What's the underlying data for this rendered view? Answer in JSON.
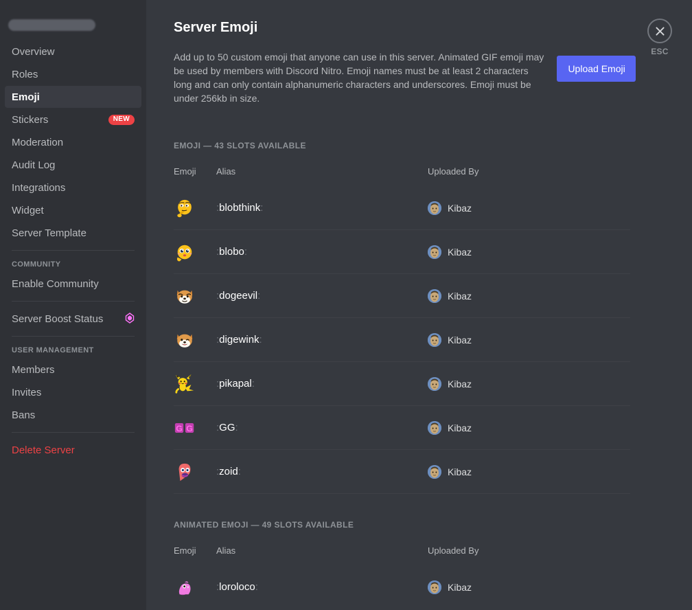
{
  "sidebar": {
    "server_name_redacted": "",
    "items": [
      {
        "label": "Overview",
        "active": false
      },
      {
        "label": "Roles",
        "active": false
      },
      {
        "label": "Emoji",
        "active": true
      },
      {
        "label": "Stickers",
        "active": false,
        "badge": "NEW"
      },
      {
        "label": "Moderation",
        "active": false
      },
      {
        "label": "Audit Log",
        "active": false
      },
      {
        "label": "Integrations",
        "active": false
      },
      {
        "label": "Widget",
        "active": false
      },
      {
        "label": "Server Template",
        "active": false
      }
    ],
    "community_header": "COMMUNITY",
    "community_items": [
      {
        "label": "Enable Community"
      }
    ],
    "boost_item": {
      "label": "Server Boost Status",
      "icon": "boost-gem-icon",
      "icon_color": "#ff73fa"
    },
    "user_management_header": "USER MANAGEMENT",
    "user_management_items": [
      {
        "label": "Members"
      },
      {
        "label": "Invites"
      },
      {
        "label": "Bans"
      }
    ],
    "danger_item": {
      "label": "Delete Server",
      "color": "#ed4245"
    }
  },
  "header": {
    "title": "Server Emoji",
    "description": "Add up to 50 custom emoji that anyone can use in this server. Animated GIF emoji may be used by members with Discord Nitro. Emoji names must be at least 2 characters long and can only contain alphanumeric characters and underscores. Emoji must be under 256kb in size.",
    "upload_button": "Upload Emoji",
    "upload_button_color": "#5865f2"
  },
  "close": {
    "icon": "close-x-icon",
    "label": "ESC"
  },
  "sections": [
    {
      "title": "EMOJI — 43 SLOTS AVAILABLE",
      "columns": {
        "emoji": "Emoji",
        "alias": "Alias",
        "uploader": "Uploaded By"
      },
      "rows": [
        {
          "emoji_name": "blobthink-emoji",
          "alias": "blobthink",
          "uploader": "Kibaz"
        },
        {
          "emoji_name": "blobo-emoji",
          "alias": "blobo",
          "uploader": "Kibaz"
        },
        {
          "emoji_name": "dogeevil-emoji",
          "alias": "dogeevil",
          "uploader": "Kibaz"
        },
        {
          "emoji_name": "digewink-emoji",
          "alias": "digewink",
          "uploader": "Kibaz"
        },
        {
          "emoji_name": "pikapal-emoji",
          "alias": "pikapal",
          "uploader": "Kibaz"
        },
        {
          "emoji_name": "gg-emoji",
          "alias": "GG",
          "uploader": "Kibaz"
        },
        {
          "emoji_name": "zoid-emoji",
          "alias": "zoid",
          "uploader": "Kibaz"
        }
      ]
    },
    {
      "title": "ANIMATED EMOJI — 49 SLOTS AVAILABLE",
      "columns": {
        "emoji": "Emoji",
        "alias": "Alias",
        "uploader": "Uploaded By"
      },
      "rows": [
        {
          "emoji_name": "loroloco-emoji",
          "alias": "loroloco",
          "uploader": "Kibaz"
        }
      ]
    }
  ],
  "colors": {
    "sidebar_bg": "#2f3136",
    "content_bg": "#36393f",
    "active_item_bg": "#3a3c43",
    "accent": "#5865f2",
    "danger": "#ed4245",
    "divider": "#3f4147",
    "muted_text": "#8e9297",
    "body_text": "#b9bbbe"
  }
}
